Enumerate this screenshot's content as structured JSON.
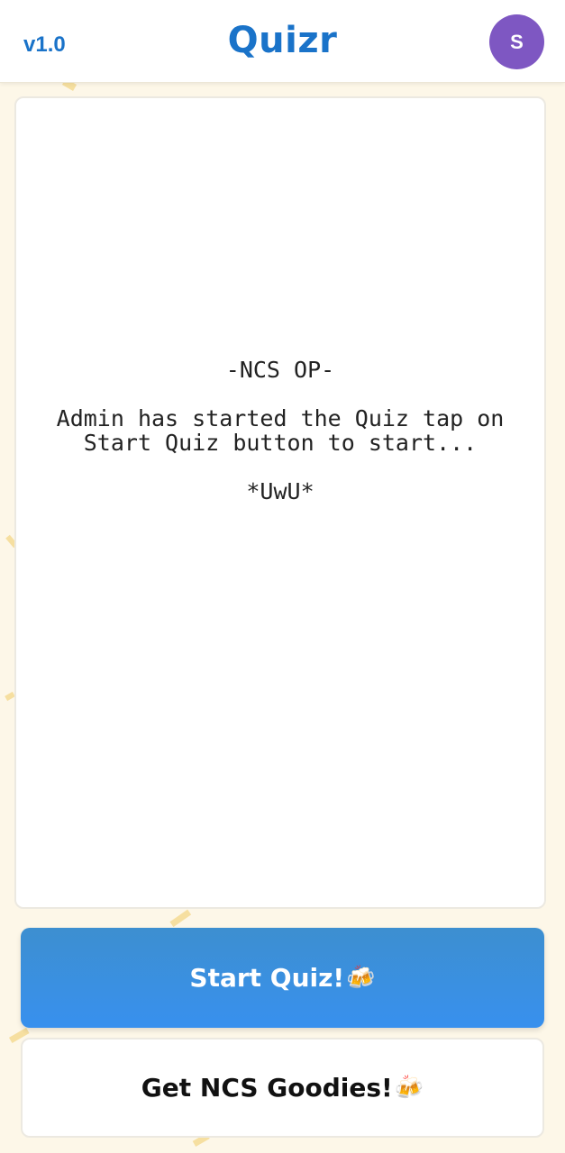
{
  "header": {
    "version": "v1.0",
    "title": "Quizr",
    "avatar_initial": "S"
  },
  "message": {
    "heading": "-NCS OP-",
    "body": "Admin has started the Quiz tap on Start Quiz button to start...",
    "tail": "*UwU*"
  },
  "buttons": {
    "start_label": "Start Quiz!",
    "goodies_label": "Get NCS Goodies!",
    "emoji": "🍻"
  },
  "colors": {
    "accent": "#1a73c9",
    "avatar": "#7e57c2",
    "start_button": "#3890ee",
    "background": "#fdf7e8"
  }
}
